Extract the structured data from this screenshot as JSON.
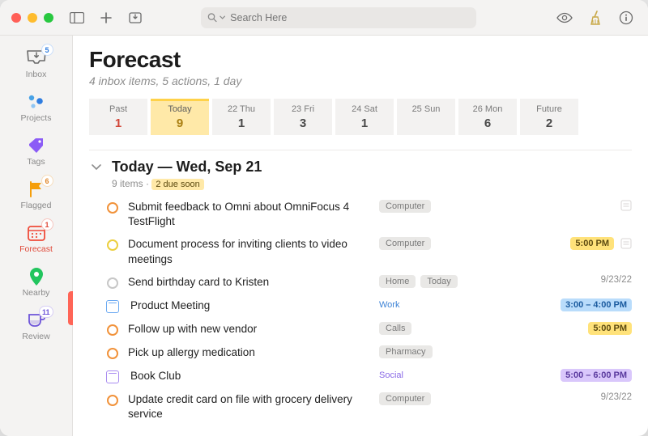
{
  "search": {
    "placeholder": "Search Here"
  },
  "sidebar": {
    "items": [
      {
        "id": "inbox",
        "label": "Inbox",
        "badge": "5"
      },
      {
        "id": "projects",
        "label": "Projects"
      },
      {
        "id": "tags",
        "label": "Tags"
      },
      {
        "id": "flagged",
        "label": "Flagged",
        "badge": "6"
      },
      {
        "id": "forecast",
        "label": "Forecast",
        "badge": "1"
      },
      {
        "id": "nearby",
        "label": "Nearby"
      },
      {
        "id": "review",
        "label": "Review",
        "badge": "11"
      }
    ]
  },
  "page": {
    "title": "Forecast",
    "subtitle": "4 inbox items, 5 actions, 1 day"
  },
  "dates": [
    {
      "label": "Past",
      "count": "1"
    },
    {
      "label": "Today",
      "count": "9"
    },
    {
      "label": "22 Thu",
      "count": "1"
    },
    {
      "label": "23 Fri",
      "count": "3"
    },
    {
      "label": "24 Sat",
      "count": "1"
    },
    {
      "label": "25 Sun",
      "count": ""
    },
    {
      "label": "26 Mon",
      "count": "6"
    },
    {
      "label": "Future",
      "count": "2"
    }
  ],
  "section": {
    "title": "Today — Wed, Sep 21",
    "count_text": "9 items",
    "separator": " · ",
    "due_text": "2 due soon"
  },
  "items": [
    {
      "title": "Submit feedback to Omni about OmniFocus 4 TestFlight",
      "tags": [
        "Computer"
      ],
      "tags_style": "gray",
      "right": {},
      "status": "ring-orange",
      "note": true
    },
    {
      "title": "Document process for inviting clients to video meetings",
      "tags": [
        "Computer"
      ],
      "tags_style": "gray",
      "right": {
        "pill": "5:00 PM",
        "pill_color": "yellow"
      },
      "status": "ring-yellow",
      "note": true
    },
    {
      "title": "Send birthday card to Kristen",
      "tags": [
        "Home",
        "Today"
      ],
      "tags_style": "gray",
      "right": {
        "text": "9/23/22"
      },
      "status": "ring-gray"
    },
    {
      "title": "Product Meeting",
      "tags": [
        "Work"
      ],
      "tags_style": "blue",
      "right": {
        "pill": "3:00 – 4:00 PM",
        "pill_color": "blue"
      },
      "status": "cal-blue"
    },
    {
      "title": "Follow up with new vendor",
      "tags": [
        "Calls"
      ],
      "tags_style": "gray",
      "right": {
        "pill": "5:00 PM",
        "pill_color": "yellow"
      },
      "status": "ring-orange"
    },
    {
      "title": "Pick up allergy medication",
      "tags": [
        "Pharmacy"
      ],
      "tags_style": "gray",
      "right": {},
      "status": "ring-orange"
    },
    {
      "title": "Book Club",
      "tags": [
        "Social"
      ],
      "tags_style": "purple",
      "right": {
        "pill": "5:00 – 6:00 PM",
        "pill_color": "purple"
      },
      "status": "cal-purple"
    },
    {
      "title": "Update credit card on file with grocery delivery service",
      "tags": [
        "Computer"
      ],
      "tags_style": "gray",
      "right": {
        "text": "9/23/22"
      },
      "status": "ring-orange"
    }
  ]
}
